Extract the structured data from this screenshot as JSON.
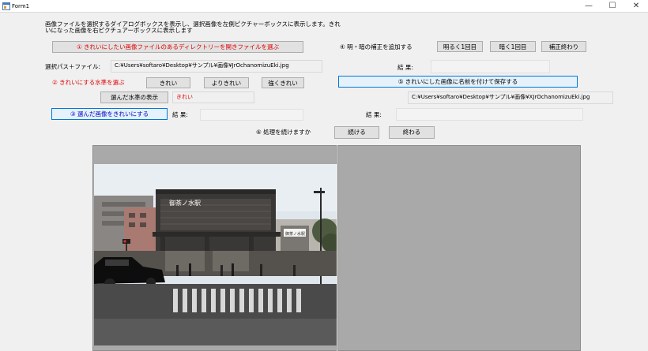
{
  "window": {
    "title": "Form1",
    "minimize_glyph": "—",
    "maximize_glyph": "☐",
    "close_glyph": "✕"
  },
  "instructions": {
    "line1": "画像ファイルを選択するダイアログボックスを表示し、選択画像を左側ピクチャーボックスに表示します。きれ",
    "line2": "いになった画像を右ピクチュアーボックスに表示します"
  },
  "step1": {
    "label": "① きれいにしたい画像ファイルのあるディレクトリーを開きファイルを選ぶ"
  },
  "path": {
    "label": "選択パス＋ファイル:",
    "value": "C:¥Users¥softaro¥Desktop¥サンプル¥画像¥JrOchanomizuEki.jpg"
  },
  "step2": {
    "label": "② きれいにする水準を選ぶ",
    "options": [
      "きれい",
      "よりきれい",
      "強くきれい"
    ]
  },
  "chosen_level": {
    "button_label": "選んだ水準の表示",
    "value": "きれい"
  },
  "step3": {
    "button_label": "③ 選んだ画像をきれいにする",
    "result_label": "結 果:",
    "result_value": ""
  },
  "step4": {
    "label": "④ 明・暗の補正を追加する",
    "buttons": [
      "明るく1回目",
      "暗く1回目",
      "補正終わり"
    ],
    "result_label": "結 果:",
    "result_value": ""
  },
  "step5": {
    "button_label": "⑤ きれいにした画像に名前を付けて保存する",
    "save_path": "C:¥Users¥softaro¥Desktop¥サンプル¥画像¥XJrOchanomizuEki.jpg",
    "result_label": "結 果:",
    "result_value": ""
  },
  "step6": {
    "label": "⑥ 処理を続けますか",
    "continue_label": "続ける",
    "end_label": "終わる"
  },
  "photo": {
    "sign_text": "御茶ノ水駅",
    "small_sign_text": "御茶ノ水駅"
  },
  "colors": {
    "accent_red": "#e00000",
    "accent_blue": "#0000cc",
    "picturebox_bg": "#a9a9a9",
    "form_bg": "#f0f0f0"
  },
  "icons": {
    "app": "app-form-icon",
    "minimize": "minimize-icon",
    "maximize": "maximize-icon",
    "close": "close-icon"
  }
}
